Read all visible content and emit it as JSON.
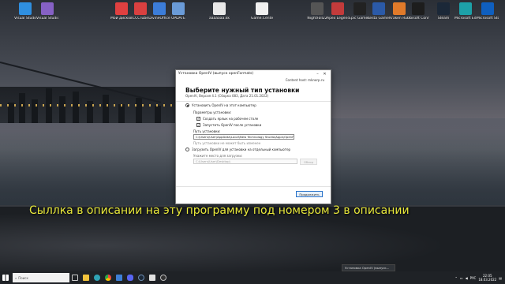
{
  "dialog": {
    "title": "Установка OpenIV (выпуск openFormats)",
    "site": "Content host: mknorp.ru",
    "heading": "Выберите нужный тип установки",
    "version": "OpenIV, Версия 4.1 (Сборка 083, Дата 21.01.2022)",
    "option_local": "Установить OpenIV на этот компьютер",
    "params_label": "Параметры установки:",
    "check_shortcut": "Создать ярлык на рабочем столе",
    "check_launch": "Запустить OpenIV после установки",
    "path_label": "Путь установки:",
    "path_value": "C:\\Users\\User\\AppData\\Local\\New Technology Studio\\Apps\\OpenIV\\",
    "path_hint": "Путь установки не может быть изменен",
    "option_remote": "Загрузить OpenIV для установки на отдельный компьютер",
    "download_label": "Укажите место для загрузки:",
    "download_value": "C:\\Users\\User\\Desktop\\",
    "browse_label": "Обзор",
    "continue_label": "Продолжить"
  },
  "overlay_text": "Сыллка в описании на эту программу под номером 3 в описании",
  "desktop": {
    "icons": [
      {
        "label": "Visual Studio Code",
        "color": "#2f8fe0"
      },
      {
        "label": "Visual Studio 2022",
        "color": "#8661c5"
      },
      {
        "label": "Мой дисковый сервис",
        "color": "#e04040"
      },
      {
        "label": "CCCTube",
        "color": "#d94040"
      },
      {
        "label": "DivineOffice",
        "color": "#3c7dd9"
      },
      {
        "label": "UPDATE",
        "color": "#6a9bd8"
      },
      {
        "label": "aaaaaaa.kk",
        "color": "#e8e8e8"
      },
      {
        "label": "Game.Center",
        "color": "#f0f0f0"
      },
      {
        "label": "NightFall22",
        "color": "#555"
      },
      {
        "label": "Apex Legends",
        "color": "#c23b3b"
      },
      {
        "label": "Epic Games Launcher",
        "color": "#222"
      },
      {
        "label": "Lesta Game Center",
        "color": "#2b5aa8"
      },
      {
        "label": "Kraken Run",
        "color": "#e07a2a"
      },
      {
        "label": "Ubisoft Connect",
        "color": "#1d1d1d"
      },
      {
        "label": "Steam",
        "color": "#1b2838"
      },
      {
        "label": "Microsoft Edge",
        "color": "#1da1a8"
      },
      {
        "label": "Microsoft Store",
        "color": "#0f5fbf"
      }
    ]
  },
  "taskbar": {
    "search_placeholder": "Поиск",
    "window_title": "Установка OpenIV (выпуск...",
    "lang": "РУС",
    "time": "22:05",
    "date": "18.03.2022"
  }
}
